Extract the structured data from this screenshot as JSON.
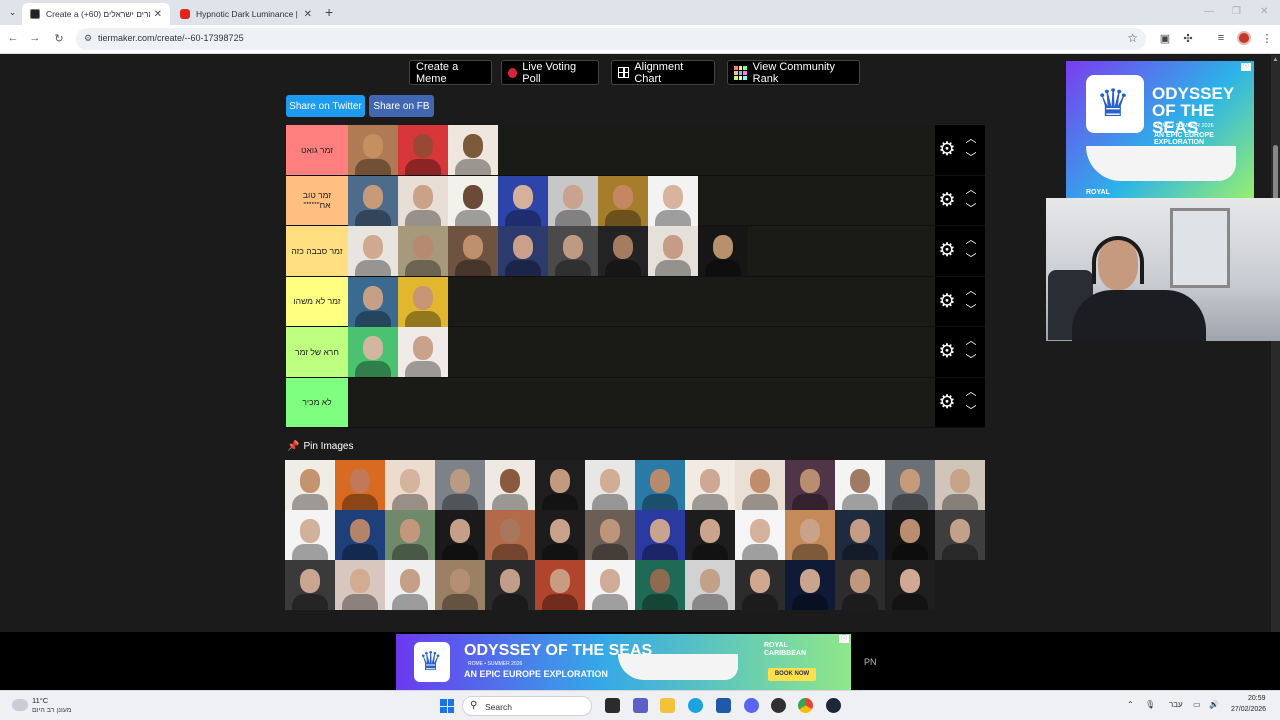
{
  "browser": {
    "tabs": [
      {
        "title": "Create a (+60) זמרים ישראלים",
        "active": true
      },
      {
        "title": "Hypnotic Dark Luminance |",
        "active": false
      }
    ],
    "url": "tiermaker.com/create/--60-17398725"
  },
  "page": {
    "top_buttons": {
      "create_meme": "Create a Meme",
      "live_voting": "Live Voting Poll",
      "alignment_chart": "Alignment Chart",
      "community_rank": "View Community Rank"
    },
    "share": {
      "twitter": "Share on Twitter",
      "fb": "Share on FB"
    },
    "tiers": [
      {
        "label": "זמר גואט",
        "color": "#ff7f7f",
        "items": [
          "#c4905f|#b07a55",
          "#9a4836|#d8373a",
          "#7c5a3c|#efe6de"
        ]
      },
      {
        "label": "זמר טוב אח''''''''''",
        "color": "#ffbf7f",
        "items": [
          "#c79a7a|#4d6b8a",
          "#caa28a|#e9ded6",
          "#6b4a38|#f3f1ec",
          "#d5b09a|#2d45a8",
          "#c9a390|#c7c7c7",
          "#c48762|#a67d2b",
          "#d8b49c|#f3f3f3"
        ]
      },
      {
        "label": "זמר סבבה כזה",
        "color": "#ffdf7f",
        "items": [
          "#d0aa90|#e8e4e0",
          "#b68a70|#a79a7c",
          "#c0906c|#6e5340",
          "#caa08a|#2c3a6e",
          "#bf9a82|#4a4a4a",
          "#a67c60|#232323",
          "#c59c85|#e5e0da",
          "#b7906e|#161616"
        ]
      },
      {
        "label": "זמר לא משהו",
        "color": "#ffff7f",
        "items": [
          "#c79e86|#3a6a8f",
          "#c69574|#e2b72e"
        ]
      },
      {
        "label": "חרא של זמר",
        "color": "#bfff7f",
        "items": [
          "#d2b6a2|#4ac270",
          "#caa28c|#f0ebe6"
        ]
      },
      {
        "label": "לא מכיר",
        "color": "#7fff7f",
        "items": []
      }
    ],
    "pin_label": "Pin Images",
    "pool": [
      "#c4946e|#f0ece6",
      "#c07a5a|#d86a22",
      "#d6b39c|#ecdccf",
      "#b89b82|#7d8288",
      "#8a5a3e|#efe9e4",
      "#c39a80|#1e1e1e",
      "#d2ad95|#e9e7e5",
      "#b78a6c|#2a7aa8",
      "#cfa894|#f1ebe4",
      "#bf8c6c|#e9dfd4",
      "#b98d70|#503447",
      "#a07a64|#f4f4f4",
      "#c79a7a|#6a7076",
      "#c7a38a|#cfc5b8",
      "#d2b19a|#f4f4f4",
      "#b3846a|#1f3f7a",
      "#c2977c|#6f8a6a",
      "#c5a088|#1a1a1a",
      "#a7785c|#b36a48",
      "#c9a08a|#1c1c1c",
      "#bf957a|#6a5e56",
      "#c8a48e|#2a3aa0",
      "#caa48c|#1d1d1d",
      "#d4b19c|#f5f5f5",
      "#caa28a|#c48a5a",
      "#c49c86|#1e2b3e",
      "#b88d70|#151515",
      "#c3a08a|#3e3e3e",
      "#c9a592|#3a3a3a",
      "#d2ab92|#d7c7bf",
      "#c5a088|#efefef",
      "#b58f74|#9a8064",
      "#c29e8a|#2a2a2a",
      "#c89c80|#b0442c",
      "#d0ac98|#f4f4f4",
      "#8e6a50|#1f6a55",
      "#c2a08a|#d2d2d2",
      "#d0a890|#2c2c2c",
      "#caa48e|#0e1a36",
      "#c09880|#2c2c2c",
      "#d0a894|#1e1e1e"
    ]
  },
  "ads": {
    "side": {
      "title": "ODYSSEY OF THE SEAS",
      "sub": "ROME • SUMMER 2026",
      "tag": "AN EPIC EUROPE EXPLORATION",
      "brand": "ROYAL"
    },
    "bottom": {
      "title": "ODYSSEY OF THE SEAS",
      "sub": "ROME • SUMMER 2026",
      "tag": "AN EPIC EUROPE EXPLORATION",
      "brand": "ROYAL CARIBBEAN",
      "cta": "BOOK NOW"
    },
    "pn": "PN"
  },
  "taskbar": {
    "temp": "11°C",
    "weather": "מעונן רב היום",
    "search": "Search",
    "lang": "עבר",
    "time": "20:59",
    "date": "27/02/2026"
  }
}
